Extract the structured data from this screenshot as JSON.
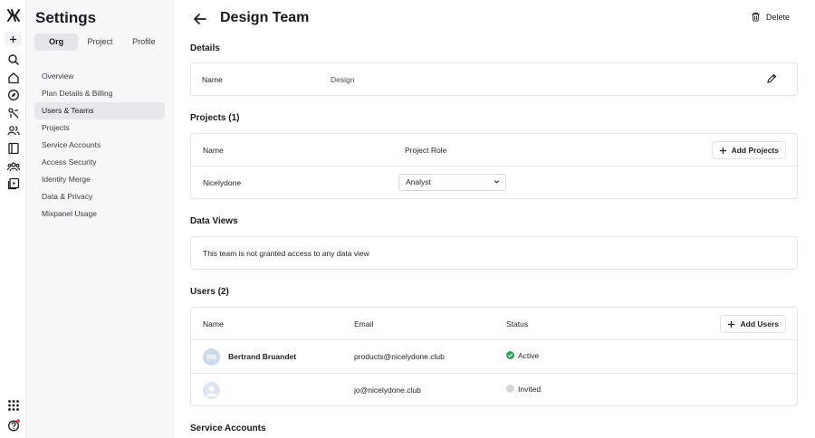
{
  "sidebar": {
    "title": "Settings",
    "segments": [
      "Org",
      "Project",
      "Profile"
    ],
    "active_segment": "Org",
    "items": [
      {
        "label": "Overview"
      },
      {
        "label": "Plan Details & Billing"
      },
      {
        "label": "Users & Teams"
      },
      {
        "label": "Projects"
      },
      {
        "label": "Service Accounts"
      },
      {
        "label": "Access Security"
      },
      {
        "label": "Identity Merge"
      },
      {
        "label": "Data & Privacy"
      },
      {
        "label": "Mixpanel Usage"
      }
    ],
    "selected_item": "Users & Teams"
  },
  "rail": {
    "icons": [
      "logo-icon",
      "add-icon",
      "search-icon",
      "home-icon",
      "discover-icon",
      "events-icon",
      "users-icon",
      "boards-icon",
      "cohorts-icon",
      "lexicon-icon",
      "apps-icon",
      "help-icon"
    ]
  },
  "header": {
    "title": "Design Team",
    "delete_label": "Delete"
  },
  "details": {
    "heading": "Details",
    "name_label": "Name",
    "name_value": "Design"
  },
  "projects": {
    "heading": "Projects (1)",
    "col_name": "Name",
    "col_role": "Project Role",
    "add_label": "Add Projects",
    "rows": [
      {
        "name": "Nicelydone",
        "role": "Analyst"
      }
    ]
  },
  "data_views": {
    "heading": "Data Views",
    "message": "This team is not granted access to any data view"
  },
  "users": {
    "heading": "Users (2)",
    "col_name": "Name",
    "col_email": "Email",
    "col_status": "Status",
    "add_label": "Add Users",
    "rows": [
      {
        "initials": "BB",
        "name": "Bertrand Bruandet",
        "email": "products@nicelydone.club",
        "status": "Active"
      },
      {
        "initials": "",
        "name": "",
        "email": "jo@nicelydone.club",
        "status": "Invited"
      }
    ]
  },
  "service_accounts": {
    "heading": "Service Accounts"
  },
  "colors": {
    "active_status": "#2e9e5b",
    "invited_status": "#d6d6da",
    "notification": "#e5484d"
  }
}
